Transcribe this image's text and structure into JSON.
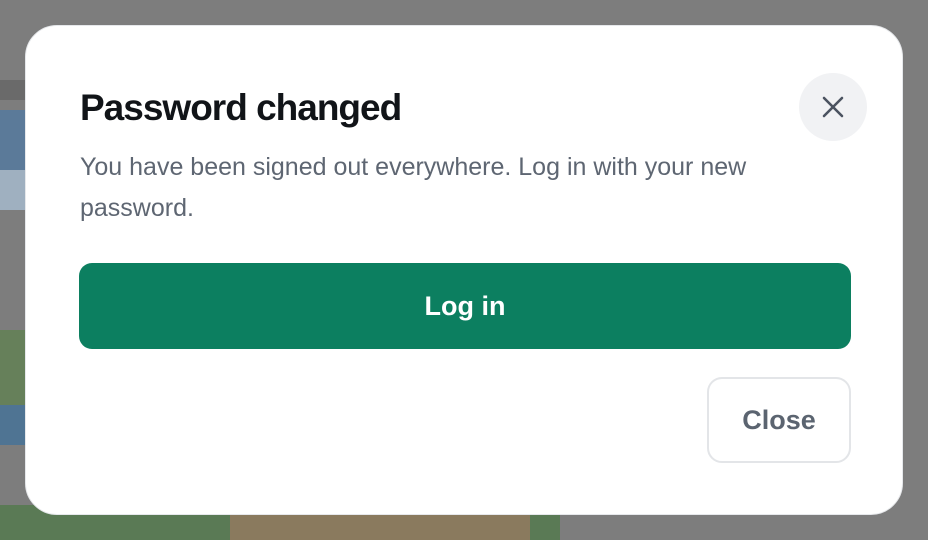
{
  "dialog": {
    "title": "Password changed",
    "message": "You have been signed out everywhere. Log in with your new password.",
    "primary_button_label": "Log in",
    "secondary_button_label": "Close",
    "close_icon": "close-icon"
  },
  "colors": {
    "primary": "#0c7f60",
    "title": "#111418",
    "message": "#5e6672",
    "backdrop": "#7d7d7d"
  }
}
